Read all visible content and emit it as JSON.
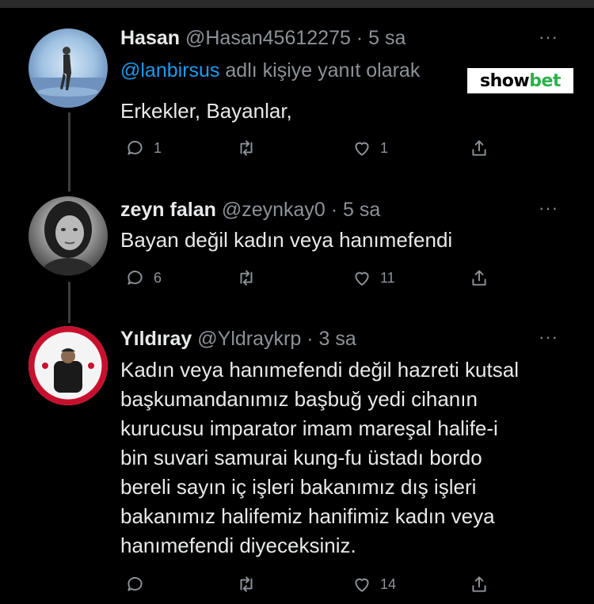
{
  "tweets": [
    {
      "name": "Hasan",
      "handle": "@Hasan45612275",
      "time": "· 5 sa",
      "reply_handle": "@lanbirsus",
      "reply_text": "adlı kişiye yanıt olarak",
      "lines": [
        "Erkekler, Bayanlar,"
      ],
      "replies": "1",
      "retweets": "",
      "likes": "1"
    },
    {
      "name": "zeyn falan",
      "handle": "@zeynkay0",
      "time": "· 5 sa",
      "lines": [
        "Bayan değil kadın veya hanımefendi"
      ],
      "replies": "6",
      "retweets": "",
      "likes": "11"
    },
    {
      "name": "Yıldıray",
      "handle": "@Yldraykrp",
      "time": "· 3 sa",
      "lines": [
        "Kadın veya hanımefendi değil hazreti kutsal",
        "başkumandanımız başbuğ yedi cihanın",
        "kurucusu imparator imam mareşal halife-i",
        "bin suvari samurai kung-fu üstadı bordo",
        "bereli sayın iç işleri bakanımız dış işleri",
        "bakanımız halifemiz hanifimiz kadın veya",
        "hanımefendi diyeceksiniz."
      ],
      "replies": "",
      "retweets": "",
      "likes": "14"
    }
  ],
  "watermark": {
    "part1": "show",
    "part2": "bet"
  },
  "more_glyph": "···",
  "colors": {
    "background": "#000000",
    "text": "#e7e9ea",
    "muted": "#8b9298",
    "link": "#1d9bf0",
    "watermark_green": "#2bb14a"
  },
  "icons": [
    "reply-icon",
    "retweet-icon",
    "like-icon",
    "share-icon",
    "more-options-icon"
  ]
}
